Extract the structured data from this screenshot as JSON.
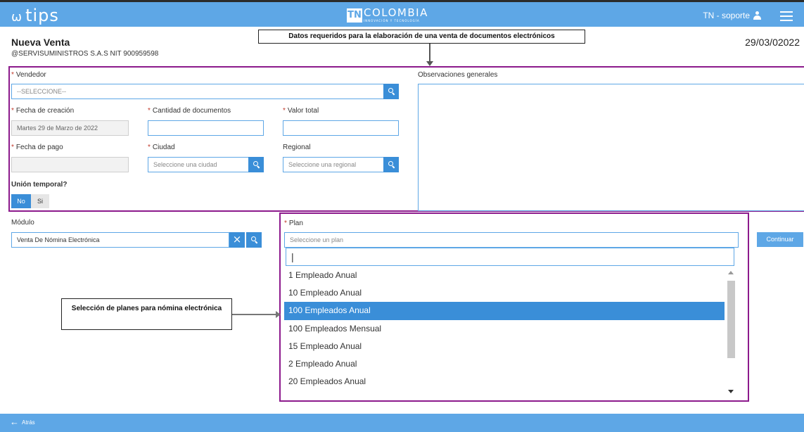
{
  "header": {
    "logo": "tips",
    "brand_mark": "TN",
    "brand_name": "COLOMBIA",
    "brand_tagline": "INNOVACIÓN Y TECNOLOGÍA",
    "user_label": "TN - soporte"
  },
  "page": {
    "title": "Nueva Venta",
    "company": "@SERVISUMINISTROS S.A.S NIT 900959598",
    "date": "29/03/02022"
  },
  "annotations": {
    "top": "Datos requeridos para la elaboración de una venta de documentos electrónicos",
    "plans": "Selección de planes para nómina electrónica"
  },
  "form": {
    "vendedor_label": "Vendedor",
    "vendedor_value": "--SELECCIONE--",
    "fecha_creacion_label": "Fecha de creación",
    "fecha_creacion_value": "Martes 29 de Marzo de 2022",
    "cantidad_label": "Cantidad de documentos",
    "valor_label": "Valor total",
    "fecha_pago_label": "Fecha de pago",
    "ciudad_label": "Ciudad",
    "ciudad_placeholder": "Seleccione una ciudad",
    "regional_label": "Regional",
    "regional_placeholder": "Seleccione una regional",
    "union_label": "Unión temporal?",
    "union_no": "No",
    "union_si": "Si",
    "observaciones_label": "Observaciones generales",
    "modulo_label": "Módulo",
    "modulo_value": "Venta De Nómina Electrónica",
    "plan_label": "Plan",
    "plan_placeholder": "Seleccione un plan",
    "continue_label": "Continuar"
  },
  "plan_options": [
    "1 Empleado Anual",
    "10 Empleado Anual",
    "100 Empleados Anual",
    "100 Empleados Mensual",
    "15 Empleado Anual",
    "2 Empleado Anual",
    "20 Empleados Anual"
  ],
  "selected_plan": "100 Empleados Anual",
  "footer": {
    "back_label": "Atrás"
  },
  "colors": {
    "primary": "#5ea7e6",
    "button": "#3a8ed8",
    "highlight_frame": "#8c1a8c",
    "required": "#c0392b"
  }
}
